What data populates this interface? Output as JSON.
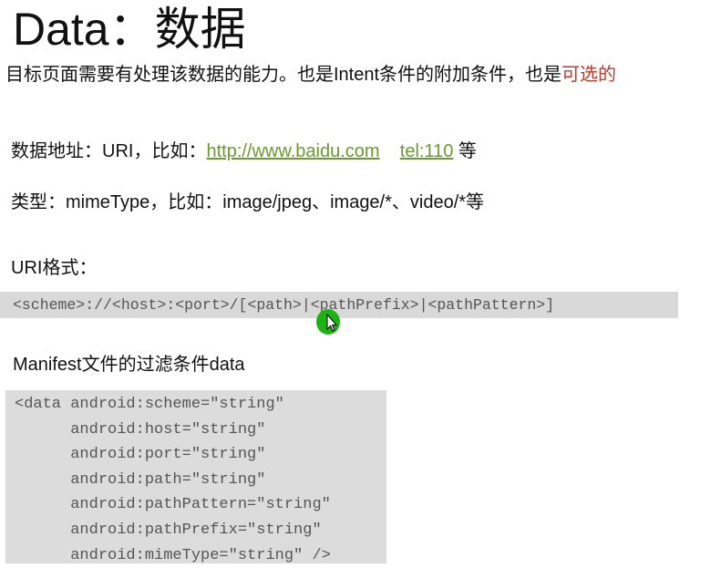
{
  "title": "Data：数据",
  "intro": {
    "text": "目标页面需要有处理该数据的能力。也是Intent条件的附加条件，也是",
    "highlight": "可选的",
    "highlight_color": "#c0392b"
  },
  "address": {
    "label": "数据地址：URI，比如：",
    "link1": "http://www.baidu.com",
    "link2": "tel:110",
    "suffix": " 等",
    "link_color": "#6a9a2c"
  },
  "type_line": "类型：mimeType，比如：image/jpeg、image/*、video/*等",
  "uri_format_label": "URI格式：",
  "uri_format": "<scheme>://<host>:<port>/[<path>|<pathPrefix>|<pathPattern>]",
  "manifest_label": "Manifest文件的过滤条件data",
  "code_lines": [
    "<data android:scheme=\"string\"",
    "      android:host=\"string\"",
    "      android:port=\"string\"",
    "      android:path=\"string\"",
    "      android:pathPattern=\"string\"",
    "      android:pathPrefix=\"string\"",
    "      android:mimeType=\"string\" />"
  ],
  "cursor_icon": "mouse-cursor-icon"
}
